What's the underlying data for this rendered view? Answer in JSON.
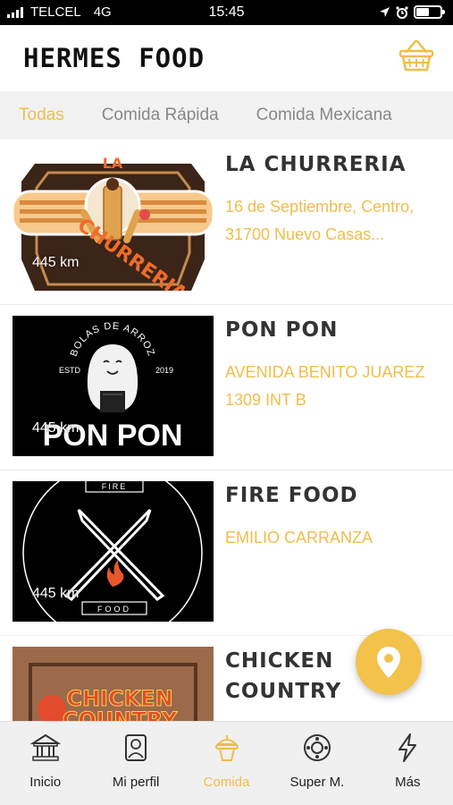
{
  "status_bar": {
    "carrier": "TELCEL",
    "network": "4G",
    "time": "15:45"
  },
  "header": {
    "title": "HERMES FOOD",
    "basket_icon": "basket-icon"
  },
  "tabs": [
    {
      "label": "Todas",
      "active": true
    },
    {
      "label": "Comida Rápida",
      "active": false
    },
    {
      "label": "Comida Mexicana",
      "active": false
    }
  ],
  "restaurants": [
    {
      "name": "LA CHURRERIA",
      "address_line1": "16 de Septiembre, Centro,",
      "address_line2": "31700 Nuevo Casas...",
      "distance": "445 km",
      "logo_text": "LA CHURRERIA"
    },
    {
      "name": "PON PON",
      "address_line1": "AVENIDA BENITO JUAREZ",
      "address_line2": "1309 INT B",
      "distance": "445 km",
      "logo_top": "BOLAS DE ARROZ",
      "logo_estd": "ESTD",
      "logo_year": "2019",
      "logo_text": "PON PON"
    },
    {
      "name": "FIRE FOOD",
      "address_line1": "EMILIO CARRANZA",
      "distance": "445 km",
      "logo_top": "FIRE",
      "logo_bottom": "FOOD"
    },
    {
      "name_line1": "CHICKEN",
      "name_line2": "COUNTRY",
      "logo_text_line1": "CHICKEN",
      "logo_text_line2": "COUNTRY"
    }
  ],
  "fab": {
    "icon": "location-pin-icon"
  },
  "bottom_nav": [
    {
      "label": "Inicio",
      "icon": "bank-icon"
    },
    {
      "label": "Mi perfil",
      "icon": "profile-icon"
    },
    {
      "label": "Comida",
      "icon": "food-icon",
      "active": true
    },
    {
      "label": "Super M.",
      "icon": "supermarket-icon"
    },
    {
      "label": "Más",
      "icon": "lightning-icon"
    }
  ],
  "colors": {
    "accent": "#f0bd4a",
    "text_dark": "#333333",
    "tab_bg": "#f2f2f2"
  }
}
